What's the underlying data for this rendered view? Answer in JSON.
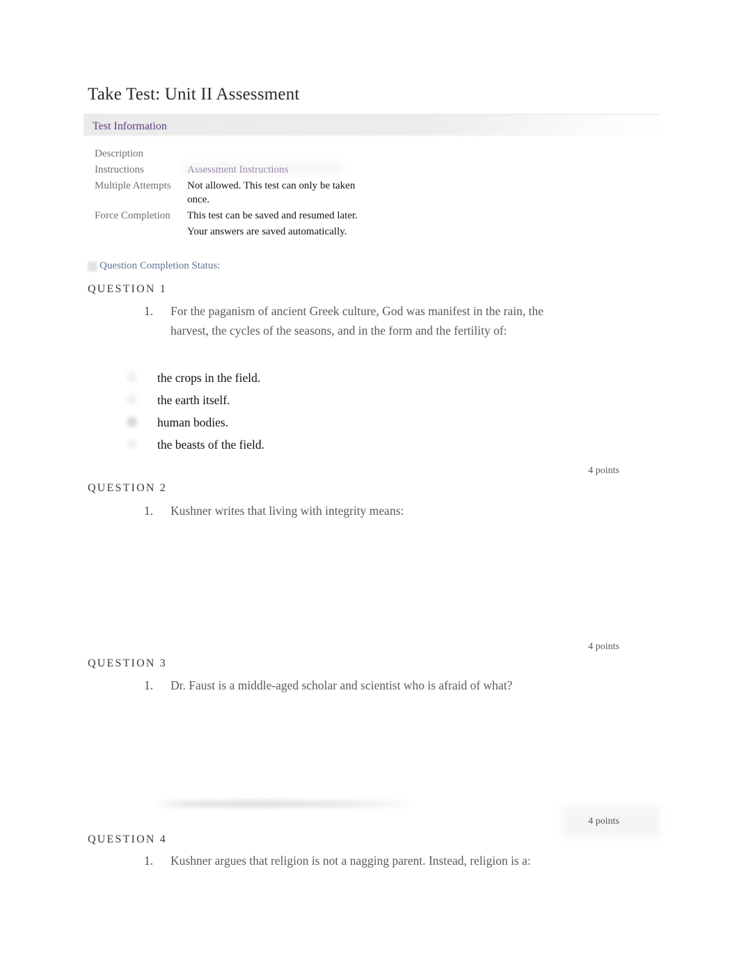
{
  "page": {
    "title": "Take Test: Unit II Assessment"
  },
  "test_information": {
    "section_title": "Test Information",
    "rows": [
      {
        "label": "Description",
        "value": "",
        "is_link": false
      },
      {
        "label": "Instructions",
        "value": "Assessment Instructions",
        "is_link": true
      },
      {
        "label": "Multiple Attempts",
        "value": "Not allowed. This test can only be taken once.",
        "is_link": false
      },
      {
        "label": "Force Completion",
        "value": "This test can be saved and resumed later.",
        "is_link": false
      },
      {
        "label": "",
        "value": "Your answers are saved automatically.",
        "is_link": false
      }
    ]
  },
  "question_completion_status": {
    "label": "Question Completion Status:",
    "icon": "collapse-icon"
  },
  "questions": [
    {
      "heading": "QUESTION 1",
      "number": "1.",
      "prompt": "For the paganism of ancient Greek culture, God was manifest in the rain, the harvest, the cycles of the seasons, and in the form and the fertility of:",
      "options": [
        {
          "label": "the crops in the field.",
          "selected": false
        },
        {
          "label": "the earth itself.",
          "selected": false
        },
        {
          "label": "human bodies.",
          "selected": true
        },
        {
          "label": "the beasts of the field.",
          "selected": false
        }
      ],
      "points": "4 points"
    },
    {
      "heading": "QUESTION 2",
      "number": "1.",
      "prompt": "Kushner writes that living with integrity means:",
      "options": [],
      "points": "4 points"
    },
    {
      "heading": "QUESTION 3",
      "number": "1.",
      "prompt": "Dr. Faust is a middle-aged scholar and scientist who is afraid of what?",
      "options": [],
      "points": "4 points"
    },
    {
      "heading": "QUESTION 4",
      "number": "1.",
      "prompt": "Kushner argues that religion is not a nagging parent. Instead, religion is a:",
      "options": [],
      "points": ""
    }
  ],
  "colors": {
    "link_purple": "#5b3a7e",
    "status_blue": "#5f7295",
    "question_text": "#5a5a5a",
    "heading_gray": "#3a3a3a"
  }
}
